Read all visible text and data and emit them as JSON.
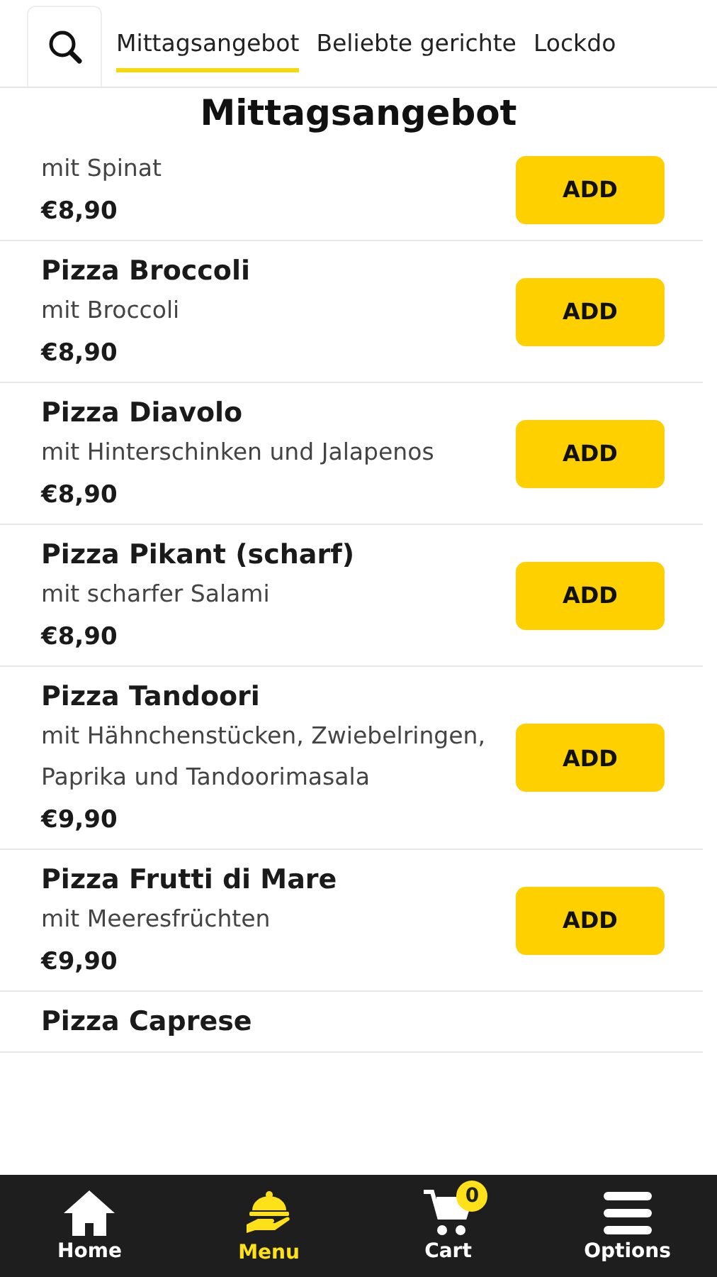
{
  "tabs": [
    {
      "label": "Mittagsangebot",
      "selected": true
    },
    {
      "label": "Beliebte gerichte",
      "selected": false
    },
    {
      "label": "Lockdo",
      "selected": false
    }
  ],
  "section_title": "Mittagsangebot",
  "items": [
    {
      "description": "mit Spinat",
      "price": "€8,90",
      "button": "ADD"
    },
    {
      "name": "Pizza Broccoli",
      "description": "mit Broccoli",
      "price": "€8,90",
      "button": "ADD"
    },
    {
      "name": "Pizza Diavolo",
      "description": "mit Hinterschinken und Jalapenos",
      "price": "€8,90",
      "button": "ADD"
    },
    {
      "name": "Pizza Pikant (scharf)",
      "description": "mit scharfer Salami",
      "price": "€8,90",
      "button": "ADD"
    },
    {
      "name": "Pizza Tandoori",
      "description": "mit Hähnchenstücken, Zwiebelringen, Paprika und Tandoorimasala",
      "price": "€9,90",
      "button": "ADD"
    },
    {
      "name": "Pizza Frutti di Mare",
      "description": "mit Meeresfrüchten",
      "price": "€9,90",
      "button": "ADD"
    },
    {
      "name": "Pizza Caprese"
    }
  ],
  "nav": [
    {
      "kind": "home",
      "label": "Home",
      "selected": false
    },
    {
      "kind": "menu",
      "label": "Menu",
      "selected": true
    },
    {
      "kind": "cart",
      "label": "Cart",
      "selected": false,
      "badge": "0"
    },
    {
      "kind": "options",
      "label": "Options",
      "selected": false
    }
  ]
}
